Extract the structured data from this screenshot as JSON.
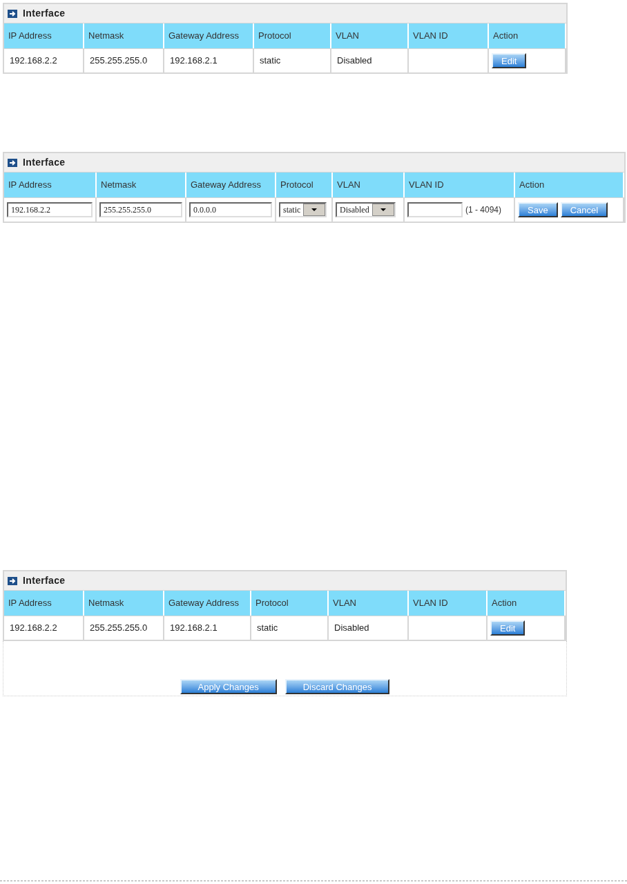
{
  "panels": [
    {
      "title": "Interface",
      "columns": [
        "IP Address",
        "Netmask",
        "Gateway Address",
        "Protocol",
        "VLAN",
        "VLAN ID",
        "Action"
      ],
      "cells": [
        {
          "kind": "text",
          "text": "192.168.2.2"
        },
        {
          "kind": "text",
          "text": "255.255.255.0"
        },
        {
          "kind": "text",
          "text": "192.168.2.1"
        },
        {
          "kind": "text",
          "text": "static"
        },
        {
          "kind": "text",
          "text": "Disabled"
        },
        {
          "kind": "empty"
        },
        {
          "kind": "buttons",
          "buttons": [
            "Edit"
          ]
        }
      ]
    },
    {
      "title": "Interface",
      "columns": [
        "IP Address",
        "Netmask",
        "Gateway Address",
        "Protocol",
        "VLAN",
        "VLAN ID",
        "Action"
      ],
      "cells": [
        {
          "kind": "input",
          "value": "192.168.2.2"
        },
        {
          "kind": "input",
          "value": "255.255.255.0"
        },
        {
          "kind": "input",
          "value": "0.0.0.0"
        },
        {
          "kind": "select",
          "value": "static"
        },
        {
          "kind": "select",
          "value": "Disabled"
        },
        {
          "kind": "input",
          "hint": "(1 - 4094)"
        },
        {
          "kind": "buttons",
          "buttons": [
            "Save",
            "Cancel"
          ]
        }
      ]
    },
    {
      "title": "Interface",
      "columns": [
        "IP Address",
        "Netmask",
        "Gateway Address",
        "Protocol",
        "VLAN",
        "VLAN ID",
        "Action"
      ],
      "cells": [
        {
          "kind": "text",
          "text": "192.168.2.2"
        },
        {
          "kind": "text",
          "text": "255.255.255.0"
        },
        {
          "kind": "text",
          "text": "192.168.2.1"
        },
        {
          "kind": "text",
          "text": "static"
        },
        {
          "kind": "text",
          "text": "Disabled"
        },
        {
          "kind": "empty"
        },
        {
          "kind": "buttons",
          "buttons": [
            "Edit"
          ]
        }
      ],
      "footer_buttons": [
        "Apply Changes",
        "Discard Changes"
      ]
    }
  ]
}
